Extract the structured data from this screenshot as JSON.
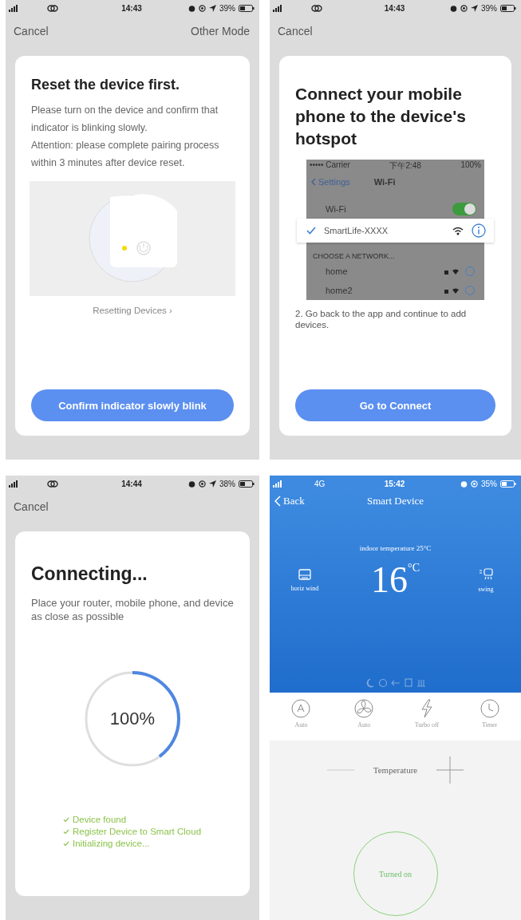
{
  "screens": [
    {
      "kind": "reset",
      "status_bar": {
        "time": "14:43",
        "battery": "39%",
        "location_on": true
      },
      "nav": {
        "left": "Cancel",
        "right": "Other Mode"
      },
      "title": "Reset the device first.",
      "paragraphs": [
        "Please turn on the device and confirm that indicator is blinking slowly.",
        "Attention: please complete pairing process within 3 minutes after device reset."
      ],
      "link": "Resetting Devices ›",
      "button": "Confirm indicator slowly blink"
    },
    {
      "kind": "hotspot",
      "status_bar": {
        "time": "14:43",
        "battery": "39%",
        "location_on": true
      },
      "nav": {
        "left": "Cancel"
      },
      "title": "Connect your mobile phone to the device's hotspot",
      "wifi_screenshot": {
        "status_carrier": "••••• Carrier",
        "status_time": "下午2:48",
        "status_battery": "100%",
        "back": "Settings",
        "title": "Wi-Fi",
        "wifi_row": {
          "label": "Wi-Fi",
          "on": true
        },
        "connected": {
          "name": "SmartLife-XXXX",
          "checked": true
        },
        "section": "CHOOSE A NETWORK...",
        "networks": [
          "home",
          "home2"
        ]
      },
      "instruction": "2. Go back to the app and continue to add devices.",
      "button": "Go to Connect"
    },
    {
      "kind": "connecting",
      "status_bar": {
        "time": "14:44",
        "battery": "38%",
        "location_on": true
      },
      "nav": {
        "left": "Cancel"
      },
      "title": "Connecting...",
      "text": "Place your router, mobile phone, and device as close as possible",
      "progress": {
        "level": 0.4,
        "label": "100%"
      },
      "steps": [
        {
          "label": "Device found",
          "done": true
        },
        {
          "label": "Register Device to Smart Cloud",
          "done": true
        },
        {
          "label": "Initializing device...",
          "done": true
        }
      ]
    },
    {
      "kind": "device",
      "status_bar": {
        "network": "4G",
        "time": "15:42",
        "battery": "35%"
      },
      "nav": {
        "back": "Back",
        "title": "Smart Device"
      },
      "indoor": "indoor temperature  25°C",
      "setpoint": "16",
      "unit": "°C",
      "side_left": "horiz wind",
      "side_right": "swing",
      "modes": [
        {
          "kind": "auto",
          "label": "Auto"
        },
        {
          "kind": "fan",
          "label": "Auto"
        },
        {
          "kind": "turbo",
          "label": "Turbo off"
        },
        {
          "kind": "timer",
          "label": "Timer"
        }
      ],
      "temperature_label": "Temperature",
      "power": {
        "label": "Turned on",
        "on": true
      }
    }
  ]
}
